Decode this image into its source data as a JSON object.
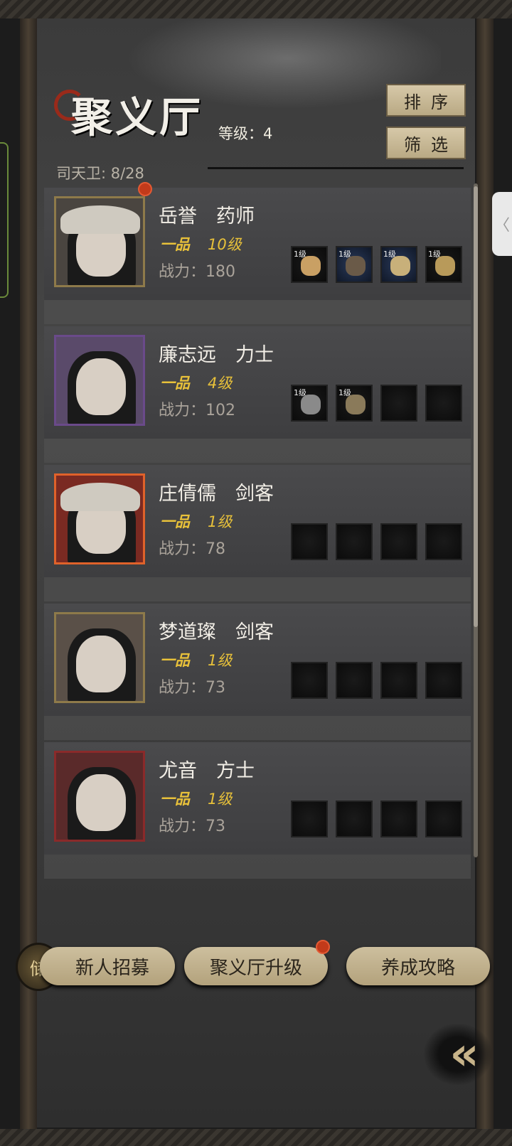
{
  "header": {
    "title": "聚义厅",
    "level_label": "等级：4",
    "guard_count": "司天卫: 8/28",
    "sort_label": "排序",
    "filter_label": "筛选"
  },
  "heroes": [
    {
      "name": "岳誉　药师",
      "grade": "一品",
      "level": "10级",
      "power": "战力：180",
      "slots": [
        "1级",
        "1级",
        "1级",
        "1级"
      ],
      "red_dot": true
    },
    {
      "name": "廉志远　力士",
      "grade": "一品",
      "level": "4级",
      "power": "战力：102",
      "slots": [
        "1级",
        "1级",
        "",
        ""
      ],
      "red_dot": false
    },
    {
      "name": "庄倩儒　剑客",
      "grade": "一品",
      "level": "1级",
      "power": "战力：78",
      "slots": [
        "",
        "",
        "",
        ""
      ],
      "red_dot": false
    },
    {
      "name": "梦道璨　剑客",
      "grade": "一品",
      "level": "1级",
      "power": "战力：73",
      "slots": [
        "",
        "",
        "",
        ""
      ],
      "red_dot": false
    },
    {
      "name": "尤音　方士",
      "grade": "一品",
      "level": "1级",
      "power": "战力：73",
      "slots": [
        "",
        "",
        "",
        ""
      ],
      "red_dot": false
    }
  ],
  "footer": {
    "recruit_label": "新人招募",
    "recruit_emblem": "储",
    "upgrade_label": "聚义厅升级",
    "guide_label": "养成攻略",
    "back_icon": "double-chevron-left-icon",
    "back_glyph": "«"
  },
  "side_tab_glyph": "〈",
  "colors": {
    "accent_gold": "#e8c13a",
    "button_tan": "#c4b48f",
    "notification_red": "#c23a1a",
    "frame_colors": [
      "#8e7a4a",
      "#6a4a8a",
      "#e0622a",
      "#8e7a4a",
      "#8a2a2a"
    ]
  }
}
